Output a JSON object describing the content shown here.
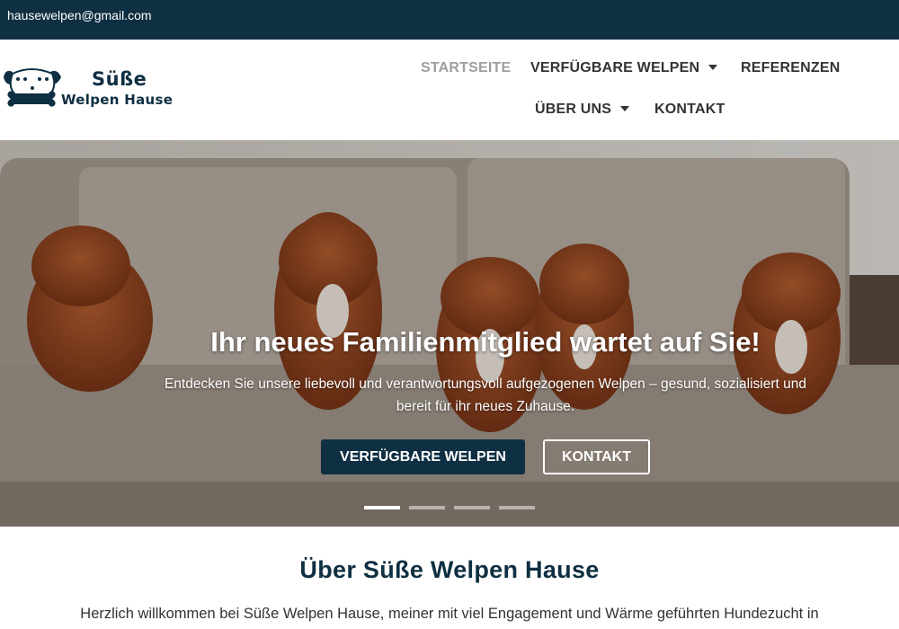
{
  "topbar": {
    "email": "hausewelpen@gmail.com"
  },
  "logo": {
    "line1": "Süße",
    "line2": "Welpen Hause"
  },
  "nav": {
    "items": [
      {
        "label": "STARTSEITE",
        "active": true
      },
      {
        "label": "VERFÜGBARE WELPEN",
        "dropdown": true
      },
      {
        "label": "REFERENZEN"
      },
      {
        "label": "ÜBER UNS",
        "dropdown": true
      },
      {
        "label": "KONTAKT"
      }
    ]
  },
  "hero": {
    "title": "Ihr neues Familienmitglied wartet auf Sie!",
    "subtitle": "Entdecken Sie unsere liebevoll und verantwortungsvoll aufgezogenen Welpen – gesund, sozialisiert und bereit für ihr neues Zuhause.",
    "primary_button": "VERFÜGBARE WELPEN",
    "secondary_button": "KONTAKT",
    "slides": {
      "count": 4,
      "active": 1
    }
  },
  "about": {
    "title": "Über Süße Welpen Hause",
    "text": "Herzlich willkommen bei Süße Welpen Hause, meiner mit viel Engagement und Wärme geführten Hundezucht in"
  },
  "colors": {
    "brand": "#0f2f42",
    "nav_text": "#333333",
    "nav_active": "#9e9e9e"
  }
}
